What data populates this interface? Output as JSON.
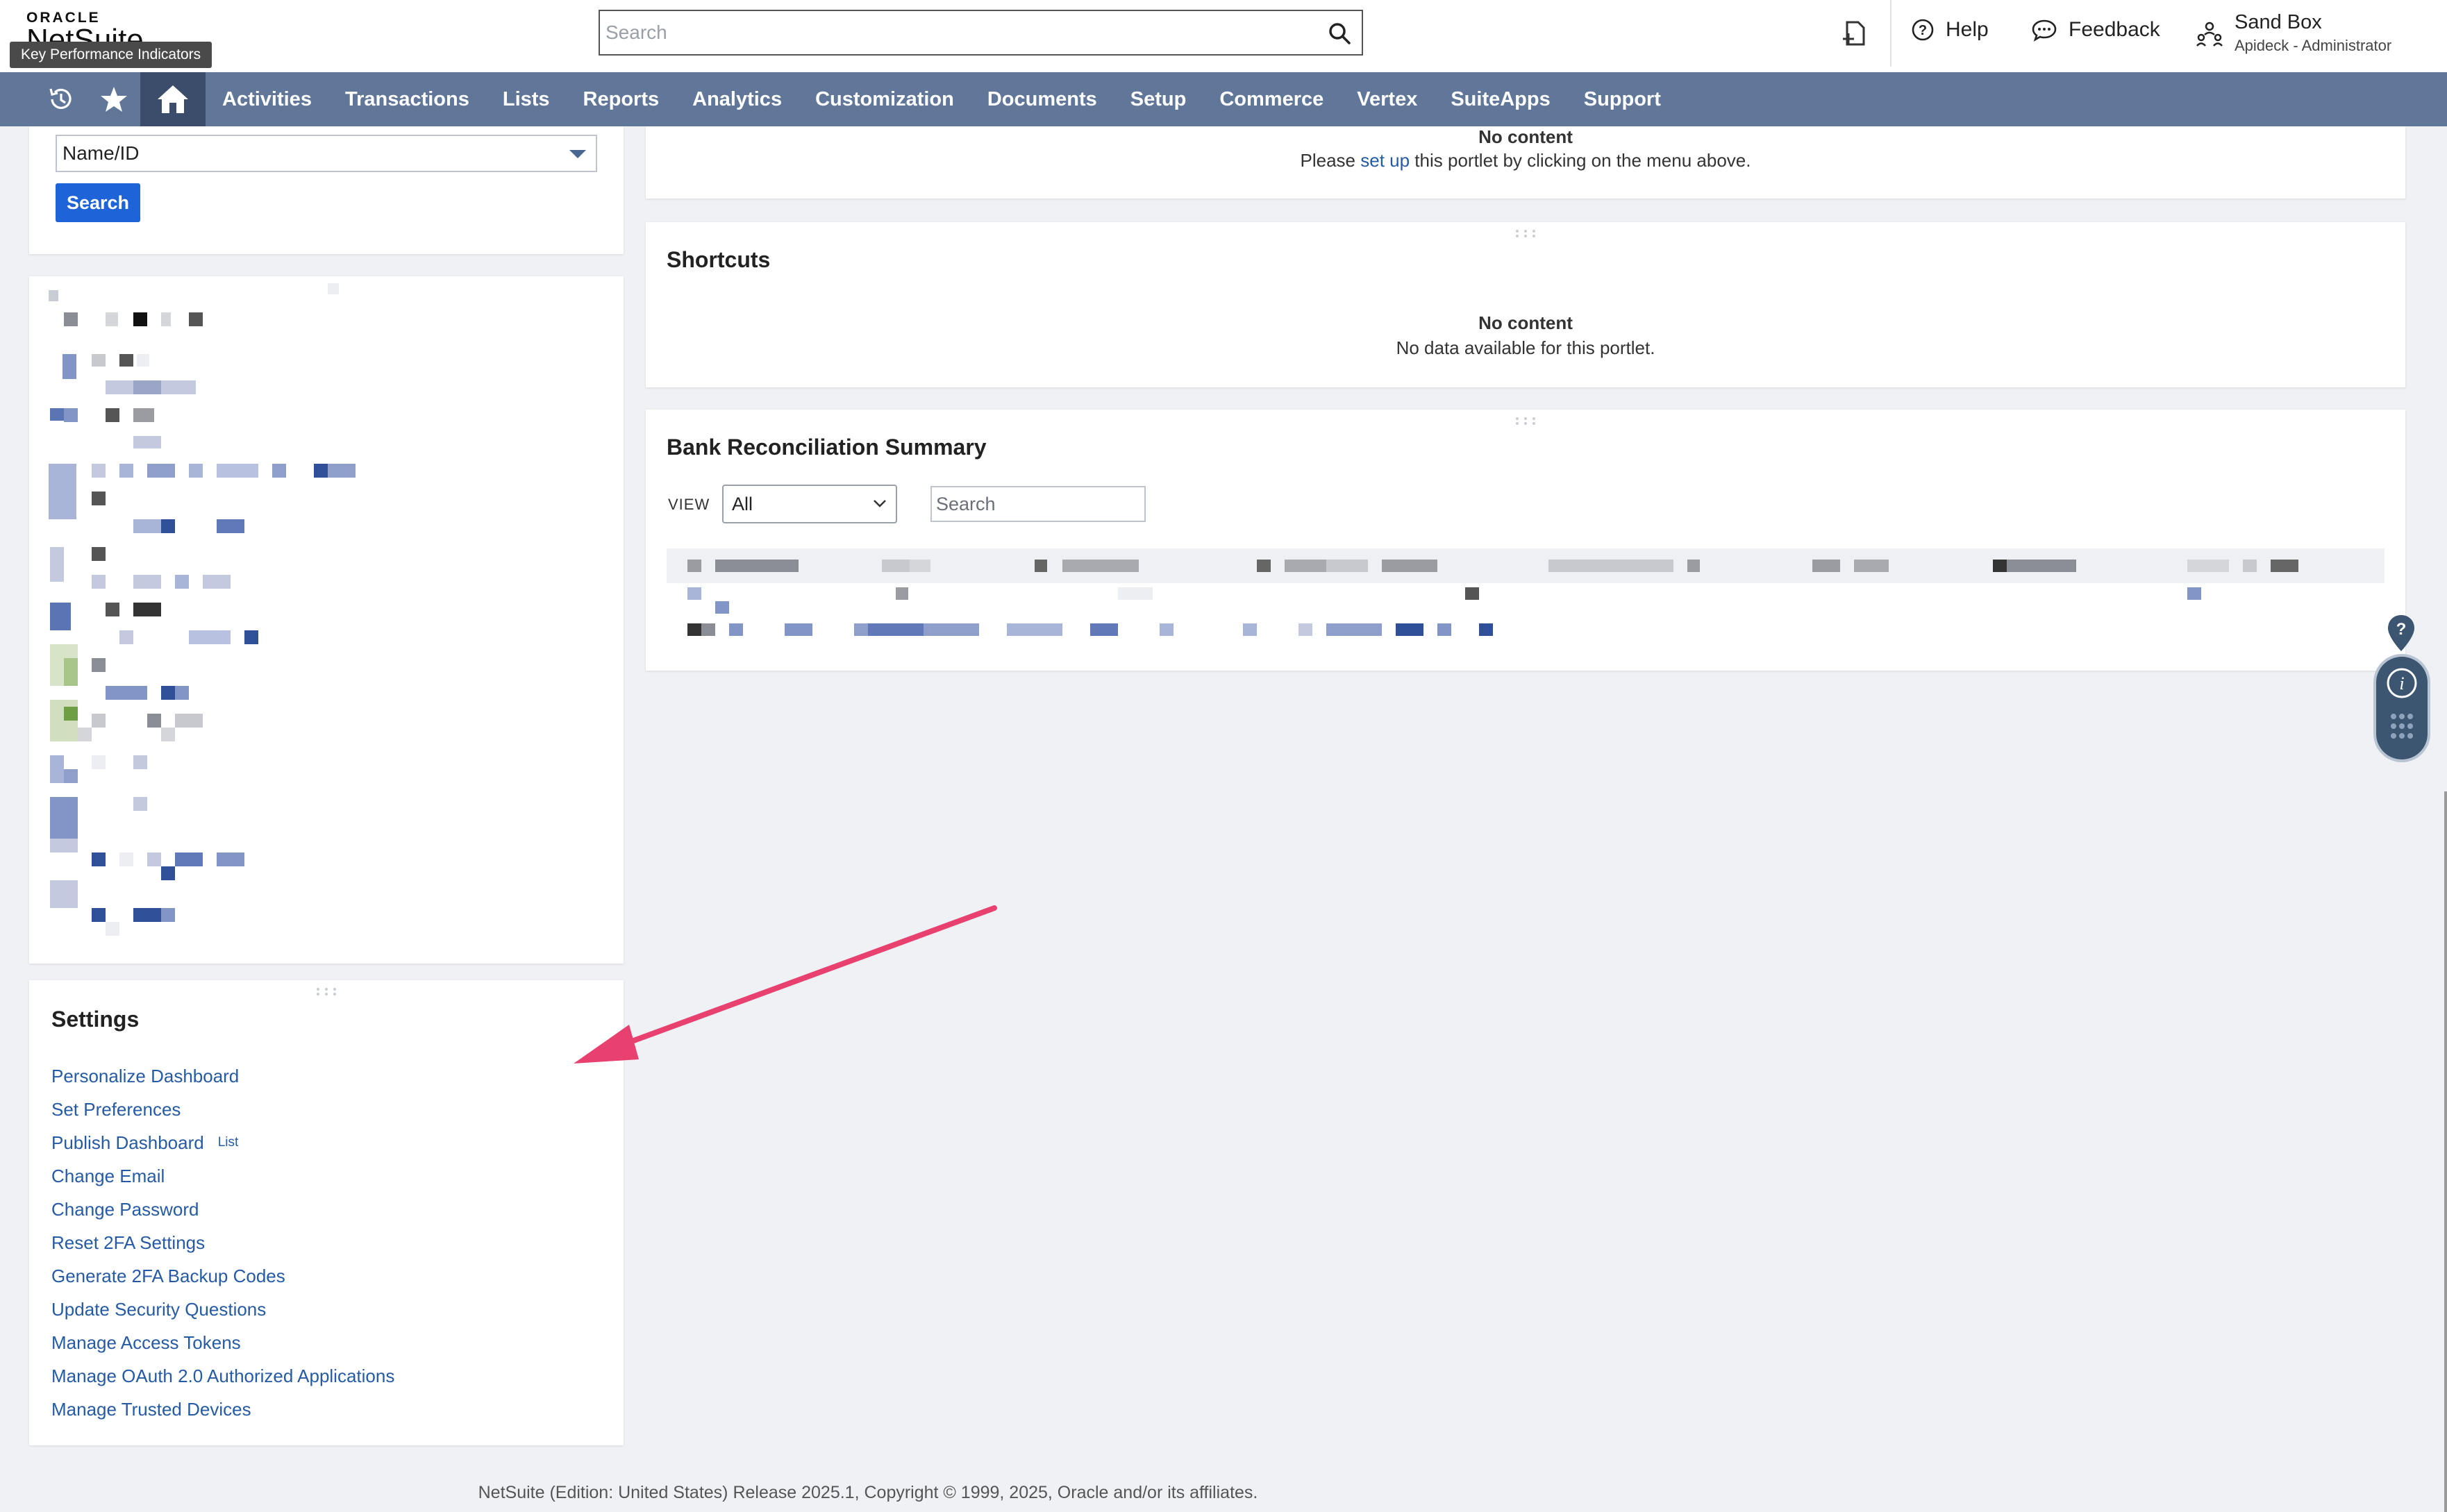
{
  "header": {
    "logo_oracle": "ORACLE",
    "logo_netsuite": "NetSuite",
    "tooltip": "Key Performance Indicators",
    "search_placeholder": "Search",
    "help_label": "Help",
    "feedback_label": "Feedback",
    "account_name": "Sand Box",
    "account_role": "Apideck - Administrator"
  },
  "nav": {
    "items": [
      "Activities",
      "Transactions",
      "Lists",
      "Reports",
      "Analytics",
      "Customization",
      "Documents",
      "Setup",
      "Commerce",
      "Vertex",
      "SuiteApps",
      "Support"
    ]
  },
  "search_portlet": {
    "select_value": "Name/ID",
    "button_label": "Search"
  },
  "top_portlet": {
    "no_content": "No content",
    "message_before": "Please ",
    "link": "set up",
    "message_after": " this portlet by clicking on the menu above."
  },
  "shortcuts": {
    "title": "Shortcuts",
    "no_content": "No content",
    "message": "No data available for this portlet."
  },
  "bank": {
    "title": "Bank Reconciliation Summary",
    "view_label": "VIEW",
    "view_value": "All",
    "search_placeholder": "Search"
  },
  "settings": {
    "title": "Settings",
    "links": [
      {
        "label": "Personalize Dashboard",
        "sub": ""
      },
      {
        "label": "Set Preferences",
        "sub": ""
      },
      {
        "label": "Publish Dashboard",
        "sub": "List"
      },
      {
        "label": "Change Email",
        "sub": ""
      },
      {
        "label": "Change Password",
        "sub": ""
      },
      {
        "label": "Reset 2FA Settings",
        "sub": ""
      },
      {
        "label": "Generate 2FA Backup Codes",
        "sub": ""
      },
      {
        "label": "Update Security Questions",
        "sub": ""
      },
      {
        "label": "Manage Access Tokens",
        "sub": ""
      },
      {
        "label": "Manage OAuth 2.0 Authorized Applications",
        "sub": ""
      },
      {
        "label": "Manage Trusted Devices",
        "sub": ""
      }
    ]
  },
  "footer": "NetSuite (Edition: United States) Release 2025.1, Copyright © 1999, 2025, Oracle and/or its affiliates.",
  "colors": {
    "nav_bg": "#607799",
    "nav_active": "#3b4d6a",
    "link": "#255ba5",
    "primary_button": "#1f63d8",
    "annotation_arrow": "#e8416f"
  }
}
